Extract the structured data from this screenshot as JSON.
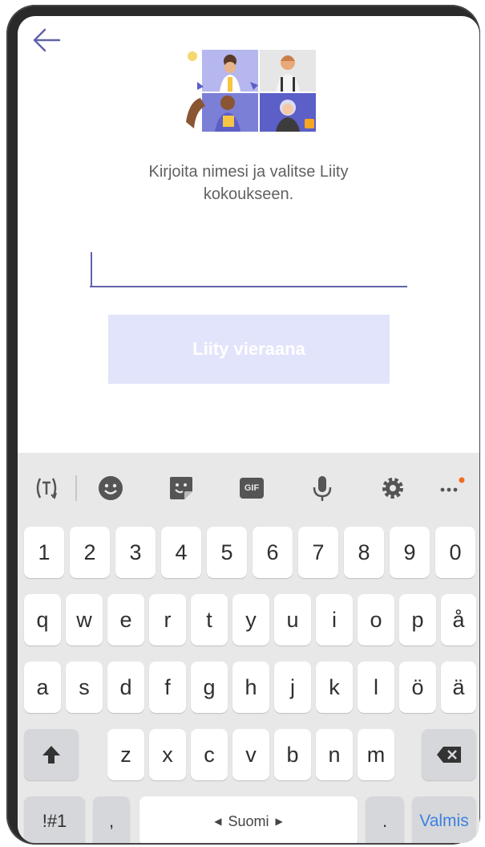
{
  "app": {
    "prompt_line1": "Kirjoita nimesi ja valitse Liity",
    "prompt_line2": "kokoukseen.",
    "name_input": {
      "value": "",
      "placeholder": ""
    },
    "join_button_label": "Liity vieraana"
  },
  "keyboard": {
    "toolbar": [
      "translate-icon",
      "emoji-icon",
      "sticker-icon",
      "gif-icon",
      "microphone-icon",
      "settings-icon",
      "more-icon"
    ],
    "gif_label": "GIF",
    "row_numbers": [
      "1",
      "2",
      "3",
      "4",
      "5",
      "6",
      "7",
      "8",
      "9",
      "0"
    ],
    "row_1": [
      "q",
      "w",
      "e",
      "r",
      "t",
      "y",
      "u",
      "i",
      "o",
      "p",
      "å"
    ],
    "row_2": [
      "a",
      "s",
      "d",
      "f",
      "g",
      "h",
      "j",
      "k",
      "l",
      "ö",
      "ä"
    ],
    "row_3": [
      "z",
      "x",
      "c",
      "v",
      "b",
      "n",
      "m"
    ],
    "symbols_label": "!#1",
    "comma_label": ",",
    "space_label": "Suomi",
    "period_label": ".",
    "done_label": "Valmis"
  },
  "colors": {
    "accent": "#6264a7",
    "join_button_disabled": "#e2e4fb",
    "keyboard_bg": "#e8e8e8",
    "done_text": "#3b80e0",
    "notification_dot": "#f26b21"
  }
}
